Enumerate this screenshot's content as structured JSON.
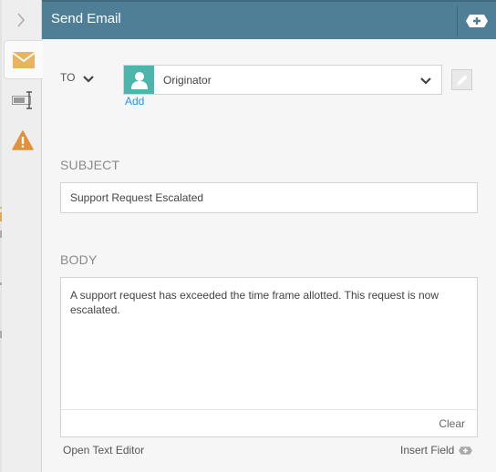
{
  "header": {
    "title": "Send Email"
  },
  "rail": {
    "tabs": [
      {
        "name": "email",
        "icon": "envelope-icon",
        "active": true
      },
      {
        "name": "text-field",
        "icon": "text-cursor-icon",
        "active": false
      },
      {
        "name": "warning",
        "icon": "warning-icon",
        "active": false
      }
    ]
  },
  "to": {
    "label": "TO",
    "recipient": "Originator",
    "add_label": "Add"
  },
  "subject": {
    "label": "SUBJECT",
    "value": "Support Request Escalated"
  },
  "body": {
    "label": "BODY",
    "value": "A support request has exceeded the time frame allotted. This request is now escalated.",
    "clear_label": "Clear"
  },
  "footer": {
    "open_editor_label": "Open Text Editor",
    "insert_field_label": "Insert Field"
  },
  "colors": {
    "header": "#4f7f97",
    "accent_teal": "#4db6ac",
    "link": "#2196f3",
    "envelope": "#e9b45f",
    "warning": "#e0913a"
  }
}
